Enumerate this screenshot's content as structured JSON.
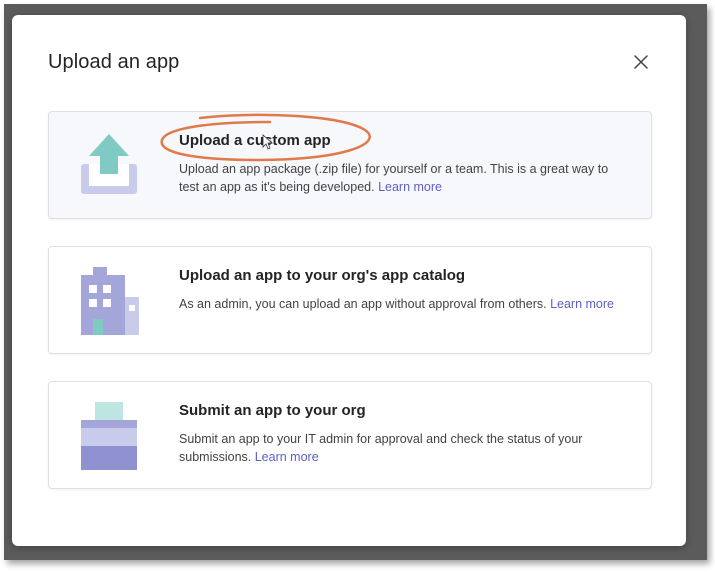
{
  "dialog": {
    "title": "Upload an app",
    "close_icon": "close-icon"
  },
  "options": [
    {
      "icon": "upload-icon",
      "title": "Upload a custom app",
      "description": "Upload an app package (.zip file) for yourself or a team. This is a great way to test an app as it's being developed.",
      "learn_more": "Learn more"
    },
    {
      "icon": "building-icon",
      "title": "Upload an app to your org's app catalog",
      "description": "As an admin, you can upload an app without approval from others.",
      "learn_more": "Learn more"
    },
    {
      "icon": "submit-box-icon",
      "title": "Submit an app to your org",
      "description": "Submit an app to your IT admin for approval and check the status of your submissions.",
      "learn_more": "Learn more"
    }
  ],
  "colors": {
    "accent": "#5b5fc7",
    "icon_teal": "#7fcbc4",
    "icon_purple": "#a4a6d9",
    "annotation": "#e07a4a"
  }
}
